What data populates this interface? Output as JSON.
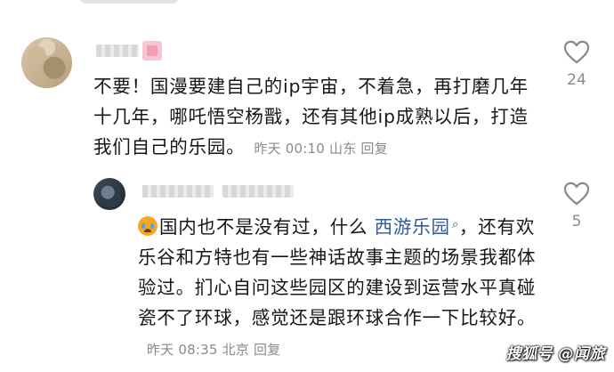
{
  "comments": [
    {
      "text": "不要！国漫要建自己的ip宇宙，不着急，再打磨几年十几年，哪吒悟空杨戬，还有其他ip成熟以后，打造我们自己的乐园。",
      "time": "昨天 00:10",
      "location": "山东",
      "reply_label": "回复",
      "likes": "24"
    },
    {
      "text_before_link": "国内也不是没有过，什么 ",
      "link_text": "西游乐园",
      "text_after_link": "，还有欢乐谷和方特也有一些神话故事主题的场景我都体验过。扪心自问这些园区的建设到运营水平真碰瓷不了环球，感觉还是跟环球合作一下比较好。",
      "time": "昨天 08:35",
      "location": "北京",
      "reply_label": "回复",
      "likes": "5"
    }
  ],
  "icons": {
    "like": "heart-outline-icon",
    "emoji": "crying-face-emoji-icon",
    "search": "search-icon"
  },
  "watermark": "搜狐号 @闻旅",
  "colors": {
    "link": "#2d5a9a",
    "meta": "#8a8a8a",
    "text": "#161616"
  }
}
